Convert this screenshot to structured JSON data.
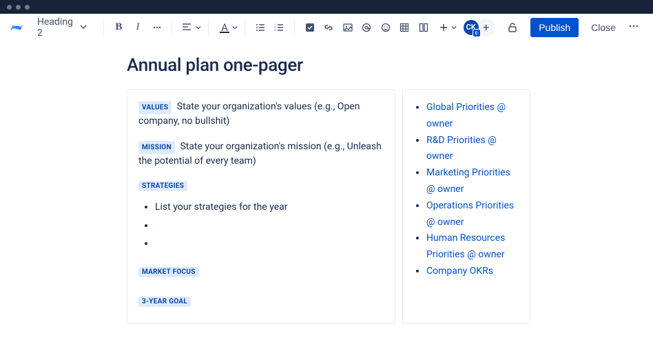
{
  "window": {
    "dots": 3
  },
  "toolbar": {
    "heading_label": "Heading 2",
    "bold": "B",
    "italic": "I",
    "text_color": "A",
    "avatar_initials": "CK",
    "avatar_badge": "c",
    "add_collab": "+",
    "publish_label": "Publish",
    "close_label": "Close"
  },
  "page": {
    "title": "Annual plan one-pager",
    "left": {
      "values_tag": "VALUES",
      "values_text": "State your organization's values (e.g., Open company, no bullshit)",
      "mission_tag": "MISSION",
      "mission_text": "State your organization's mission (e.g., Unleash the potential of every team)",
      "strategies_tag": "STRATEGIES",
      "strategies_items": [
        "List your strategies for the year",
        "",
        ""
      ],
      "market_focus_tag": "MARKET FOCUS",
      "three_year_tag": "3-YEAR GOAL"
    },
    "right": {
      "links": [
        "Global Priorities @ owner",
        "R&D Priorities @ owner",
        "Marketing Priorities @ owner",
        "Operations Priorities @ owner",
        "Human Resources Priorities @ owner",
        " Company OKRs"
      ]
    }
  }
}
